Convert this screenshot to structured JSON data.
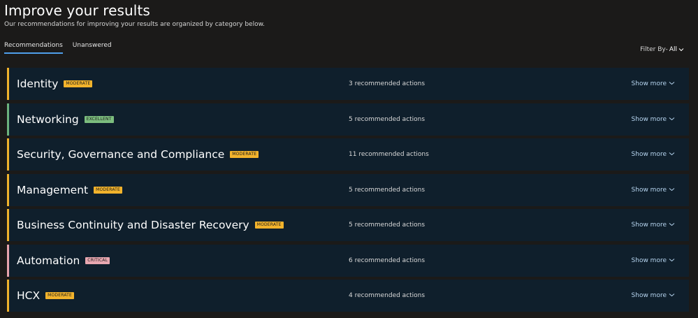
{
  "header": {
    "title": "Improve your results",
    "subtitle": "Our recommendations for improving your results are organized by category below."
  },
  "tabs": [
    {
      "label": "Recommendations",
      "active": true
    },
    {
      "label": "Unanswered",
      "active": false
    }
  ],
  "filter": {
    "label": "Filter By-",
    "value": "All",
    "icon": "chevron-down-icon"
  },
  "categories": [
    {
      "name": "Identity",
      "badge": "MODERATE",
      "actions": "3 recommended actions",
      "show_more": "Show more",
      "status_color": "#f2b32c",
      "badge_color": "#f2b32c"
    },
    {
      "name": "Networking",
      "badge": "EXCELLENT",
      "actions": "5 recommended actions",
      "show_more": "Show more",
      "status_color": "#6cb37e",
      "badge_color": "#7cbd7e"
    },
    {
      "name": "Security, Governance and Compliance",
      "badge": "MODERATE",
      "actions": "11 recommended actions",
      "show_more": "Show more",
      "status_color": "#f2b32c",
      "badge_color": "#f2b32c"
    },
    {
      "name": "Management",
      "badge": "MODERATE",
      "actions": "5 recommended actions",
      "show_more": "Show more",
      "status_color": "#f2b32c",
      "badge_color": "#f2b32c"
    },
    {
      "name": "Business Continuity and Disaster Recovery",
      "badge": "MODERATE",
      "actions": "5 recommended actions",
      "show_more": "Show more",
      "status_color": "#f2b32c",
      "badge_color": "#f2b32c"
    },
    {
      "name": "Automation",
      "badge": "CRITICAL",
      "actions": "6 recommended actions",
      "show_more": "Show more",
      "status_color": "#e7a3ad",
      "badge_color": "#e8a7b0"
    },
    {
      "name": "HCX",
      "badge": "MODERATE",
      "actions": "4 recommended actions",
      "show_more": "Show more",
      "status_color": "#f2b32c",
      "badge_color": "#f2b32c"
    }
  ]
}
